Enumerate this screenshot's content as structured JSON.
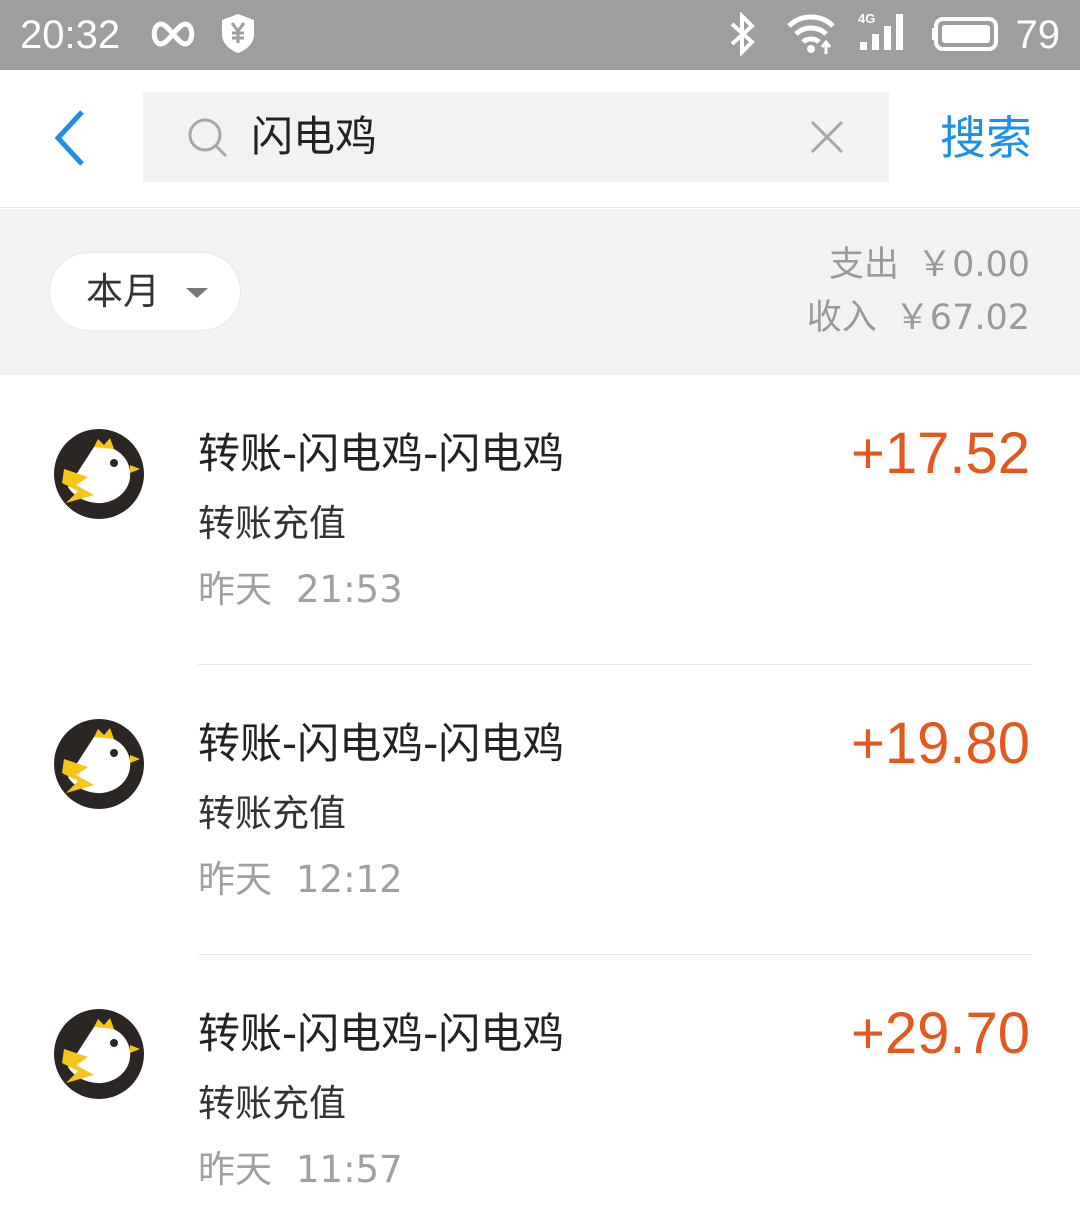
{
  "status_bar": {
    "time": "20:32",
    "battery": "79",
    "network": "4G",
    "icons": [
      "infinity-icon",
      "shield-yen-icon",
      "bluetooth-icon",
      "wifi-icon",
      "signal-icon",
      "battery-icon"
    ]
  },
  "header": {
    "back_icon": "chevron-left-icon",
    "search_icon": "search-icon",
    "query": "闪电鸡",
    "clear_icon": "close-icon",
    "search_button": "搜索"
  },
  "summary": {
    "period": "本月",
    "expense_label": "支出",
    "expense_value": "￥0.00",
    "income_label": "收入",
    "income_value": "￥67.02"
  },
  "transactions": [
    {
      "title": "转账-闪电鸡-闪电鸡",
      "subtitle": "转账充值",
      "day": "昨天",
      "time": "21:53",
      "amount": "+17.52",
      "icon": "lightning-chicken-logo-icon"
    },
    {
      "title": "转账-闪电鸡-闪电鸡",
      "subtitle": "转账充值",
      "day": "昨天",
      "time": "12:12",
      "amount": "+19.80",
      "icon": "lightning-chicken-logo-icon"
    },
    {
      "title": "转账-闪电鸡-闪电鸡",
      "subtitle": "转账充值",
      "day": "昨天",
      "time": "11:57",
      "amount": "+29.70",
      "icon": "lightning-chicken-logo-icon"
    }
  ],
  "colors": {
    "accent": "#1e8fe6",
    "amount": "#e4571e",
    "status_bar": "#9e9e9e"
  }
}
